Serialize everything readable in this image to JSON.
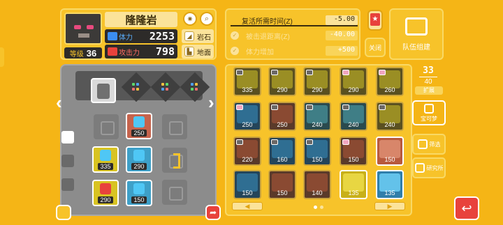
{
  "pokemon": {
    "name": "隆隆岩",
    "level_label": "等级",
    "level": "36",
    "hp_label": "体力",
    "hp": "2253",
    "atk_label": "攻击力",
    "atk": "798",
    "type1": "岩石",
    "type2": "地面"
  },
  "bonuses": [
    {
      "label": "复活所需时间(Z)",
      "value": "-5.00"
    },
    {
      "label": "被击退距离(Z)",
      "value": "-40.00"
    },
    {
      "label": "体力增加",
      "value": "+500"
    }
  ],
  "close_label": "关闭",
  "team_build_label": "队伍组建",
  "board_stones": [
    {
      "value": "250"
    },
    {
      "value": "335"
    },
    {
      "value": "290"
    },
    {
      "value": "290"
    },
    {
      "value": "150"
    }
  ],
  "inventory": [
    [
      "335",
      "290",
      "290",
      "290",
      "260"
    ],
    [
      "250",
      "250",
      "240",
      "240",
      "240"
    ],
    [
      "220",
      "160",
      "150",
      "150",
      "150"
    ],
    [
      "150",
      "150",
      "140",
      "135",
      "135"
    ]
  ],
  "capacity": {
    "current": "33",
    "max": "40",
    "expand_label": "扩展"
  },
  "buttons": {
    "pokemon": "宝可梦",
    "sort": "筛选",
    "lab": "研究所"
  },
  "colors": {
    "background": "#f5b516",
    "panel": "#f7c32a",
    "accent_red": "#e8423c"
  }
}
